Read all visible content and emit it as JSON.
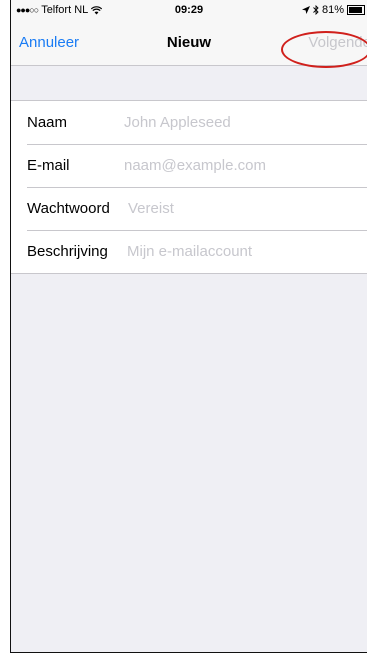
{
  "status_bar": {
    "carrier": "Telfort NL",
    "time": "09:29",
    "battery": "81%",
    "signal_dots": "●●●○○",
    "icons": [
      "wifi-icon",
      "location-arrow-icon",
      "bluetooth-icon",
      "battery-icon"
    ]
  },
  "nav": {
    "cancel_label": "Annuleer",
    "title": "Nieuw",
    "next_label": "Volgende"
  },
  "form": {
    "fields": [
      {
        "label": "Naam",
        "placeholder": "John Appleseed",
        "value": ""
      },
      {
        "label": "E-mail",
        "placeholder": "naam@example.com",
        "value": ""
      },
      {
        "label": "Wachtwoord",
        "placeholder": "Vereist",
        "value": ""
      },
      {
        "label": "Beschrijving",
        "placeholder": "Mijn e-mailaccount",
        "value": ""
      }
    ]
  },
  "colors": {
    "accent": "#1a7cf4",
    "disabled": "#c7c7cc",
    "annotation": "#d0201c",
    "background": "#efeff4"
  }
}
